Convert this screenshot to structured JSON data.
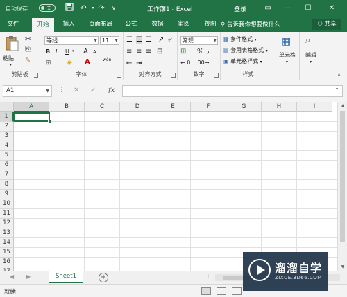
{
  "titlebar": {
    "autosave_label": "自动保存",
    "autosave_state": "关",
    "doc_title": "工作簿1  -  Excel",
    "login_label": "登录",
    "qat": {
      "save_icon": "save-icon",
      "undo_icon": "undo-icon",
      "redo_icon": "redo-icon"
    }
  },
  "tabs": [
    {
      "label": "文件",
      "active": false
    },
    {
      "label": "开始",
      "active": true
    },
    {
      "label": "插入",
      "active": false
    },
    {
      "label": "页面布局",
      "active": false
    },
    {
      "label": "公式",
      "active": false
    },
    {
      "label": "数据",
      "active": false
    },
    {
      "label": "审阅",
      "active": false
    },
    {
      "label": "视图",
      "active": false
    }
  ],
  "tellme": "告诉我你想要做什么",
  "share_label": "共享",
  "ribbon": {
    "clipboard": {
      "paste_label": "粘贴",
      "group_label": "剪贴板"
    },
    "font": {
      "font_name": "等线",
      "font_size": "11",
      "group_label": "字体",
      "bold": "B",
      "italic": "I",
      "underline": "U",
      "grow": "A",
      "shrink": "A",
      "font_color": "A",
      "wen": "wén"
    },
    "alignment": {
      "group_label": "对齐方式"
    },
    "number": {
      "format": "常规",
      "group_label": "数字",
      "percent": "%",
      "comma": ","
    },
    "styles": {
      "conditional": "条件格式",
      "table": "套用表格格式",
      "cell": "单元格样式",
      "group_label": "样式"
    },
    "cells": {
      "label": "单元格"
    },
    "editing": {
      "label": "编辑"
    }
  },
  "formula_bar": {
    "name_box": "A1",
    "fx": "fx",
    "cancel": "✕",
    "enter": "✓",
    "value": ""
  },
  "grid": {
    "columns": [
      "A",
      "B",
      "C",
      "D",
      "E",
      "F",
      "G",
      "H",
      "I"
    ],
    "rows": [
      "1",
      "2",
      "3",
      "4",
      "5",
      "6",
      "7",
      "8",
      "9",
      "10",
      "11",
      "12",
      "13",
      "14",
      "15",
      "16",
      "17"
    ],
    "active_cell": "A1"
  },
  "sheets": {
    "tabs": [
      "Sheet1"
    ],
    "add_label": "+"
  },
  "status": {
    "ready": "就绪"
  },
  "watermark": {
    "title": "溜溜自学",
    "subtitle": "ZIXUE.3D66.COM"
  },
  "colors": {
    "excel_green": "#217346",
    "ribbon_bg": "#f3f3f3"
  }
}
